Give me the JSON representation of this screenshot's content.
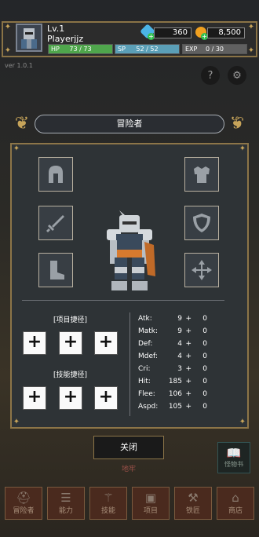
{
  "header": {
    "level": "Lv.1",
    "player_name": "Playerjjz",
    "gems": "360",
    "gold": "8,500",
    "hp_label": "HP",
    "hp_value": "73 / 73",
    "hp_fraction": 1.0,
    "sp_label": "SP",
    "sp_value": "52 / 52",
    "sp_fraction": 1.0,
    "exp_label": "EXP",
    "exp_value": "0 / 30",
    "exp_fraction": 0.0
  },
  "version": "ver 1.0.1",
  "help_glyph": "?",
  "panel": {
    "title": "冒险者",
    "item_shortcut_label": "[项目捷径]",
    "skill_shortcut_label": "[技能捷径]",
    "plus_glyph": "+",
    "stats": [
      {
        "name": "Atk:",
        "base": "9",
        "op": "+",
        "bonus": "0"
      },
      {
        "name": "Matk:",
        "base": "9",
        "op": "+",
        "bonus": "0"
      },
      {
        "name": "Def:",
        "base": "4",
        "op": "+",
        "bonus": "0"
      },
      {
        "name": "Mdef:",
        "base": "4",
        "op": "+",
        "bonus": "0"
      },
      {
        "name": "Cri:",
        "base": "3",
        "op": "+",
        "bonus": "0"
      },
      {
        "name": "Hit:",
        "base": "185",
        "op": "+",
        "bonus": "0"
      },
      {
        "name": "Flee:",
        "base": "106",
        "op": "+",
        "bonus": "0"
      },
      {
        "name": "Aspd:",
        "base": "105",
        "op": "+",
        "bonus": "0"
      }
    ]
  },
  "close_button": "关闭",
  "dungeon_label": "地牢",
  "monster_book_label": "怪物书",
  "nav": [
    {
      "label": "冒险者",
      "icon": "helmet-icon"
    },
    {
      "label": "能力",
      "icon": "sliders-icon"
    },
    {
      "label": "技能",
      "icon": "wand-icon"
    },
    {
      "label": "项目",
      "icon": "bag-icon"
    },
    {
      "label": "铁匠",
      "icon": "anvil-icon"
    },
    {
      "label": "商店",
      "icon": "shop-icon"
    }
  ],
  "colors": {
    "hp": "#4fa64c",
    "sp": "#5b9fb7",
    "exp": "#606060",
    "gold_frame": "#8c7548"
  }
}
